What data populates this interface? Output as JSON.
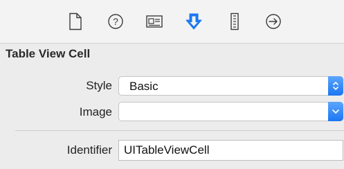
{
  "toolbar": {
    "tabs": [
      {
        "name": "file-inspector",
        "icon": "file-icon",
        "selected": false
      },
      {
        "name": "quick-help-inspector",
        "icon": "question-circle-icon",
        "selected": false
      },
      {
        "name": "identity-inspector",
        "icon": "id-card-icon",
        "selected": false
      },
      {
        "name": "attributes-inspector",
        "icon": "attributes-arrow-icon",
        "selected": true
      },
      {
        "name": "size-inspector",
        "icon": "ruler-icon",
        "selected": false
      },
      {
        "name": "connections-inspector",
        "icon": "arrow-circle-icon",
        "selected": false
      }
    ],
    "accent_color": "#1b78f2"
  },
  "section": {
    "title": "Table View Cell"
  },
  "style": {
    "label": "Style",
    "value": "Basic"
  },
  "image": {
    "label": "Image",
    "value": ""
  },
  "identifier": {
    "label": "Identifier",
    "value": "UITableViewCell"
  }
}
